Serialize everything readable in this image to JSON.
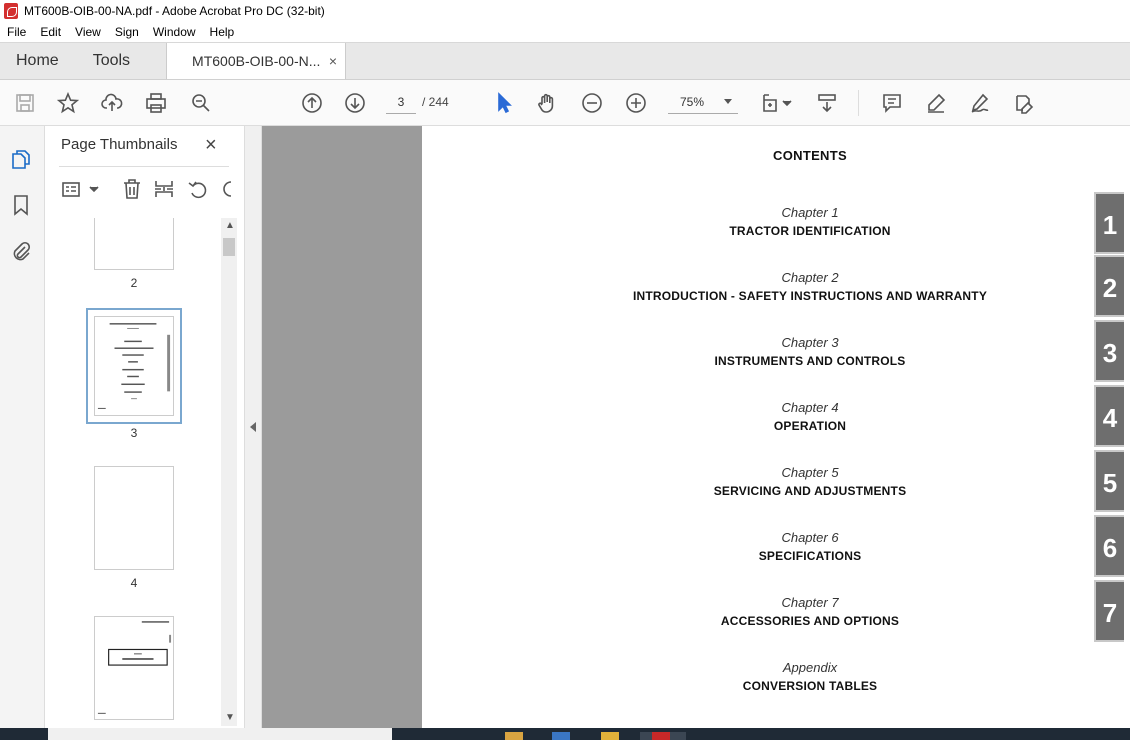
{
  "window": {
    "title": "MT600B-OIB-00-NA.pdf - Adobe Acrobat Pro DC (32-bit)"
  },
  "menu": [
    "File",
    "Edit",
    "View",
    "Sign",
    "Window",
    "Help"
  ],
  "tabs": {
    "home": "Home",
    "tools": "Tools",
    "document": "MT600B-OIB-00-N...",
    "close": "×"
  },
  "toolbar": {
    "current_page": "3",
    "page_total": "/  244",
    "zoom": "75%"
  },
  "panel": {
    "title": "Page Thumbnails",
    "close": "×",
    "thumbnails": [
      {
        "label": "2"
      },
      {
        "label": "3"
      },
      {
        "label": "4"
      },
      {
        "label": ""
      }
    ]
  },
  "document": {
    "heading": "CONTENTS",
    "chapters": [
      {
        "label": "Chapter 1",
        "name": "TRACTOR IDENTIFICATION"
      },
      {
        "label": "Chapter 2",
        "name": "INTRODUCTION - SAFETY INSTRUCTIONS AND WARRANTY"
      },
      {
        "label": "Chapter 3",
        "name": "INSTRUMENTS AND CONTROLS"
      },
      {
        "label": "Chapter 4",
        "name": "OPERATION"
      },
      {
        "label": "Chapter 5",
        "name": "SERVICING AND ADJUSTMENTS"
      },
      {
        "label": "Chapter 6",
        "name": "SPECIFICATIONS"
      },
      {
        "label": "Chapter 7",
        "name": "ACCESSORIES AND OPTIONS"
      },
      {
        "label": "Appendix",
        "name": "CONVERSION TABLES"
      }
    ],
    "side_tabs": [
      "1",
      "2",
      "3",
      "4",
      "5",
      "6",
      "7"
    ]
  }
}
